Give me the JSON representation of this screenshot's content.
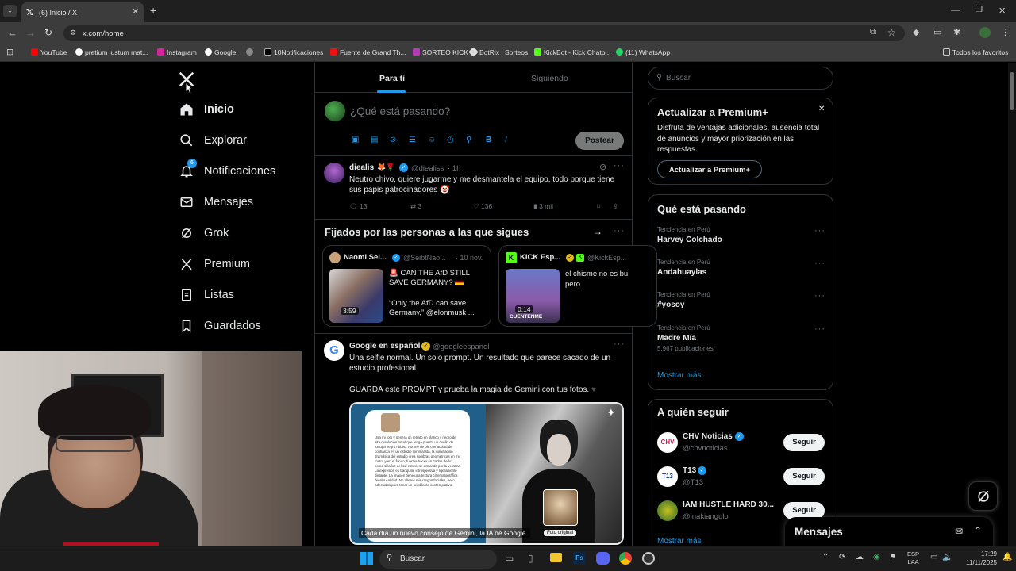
{
  "browser": {
    "tab_title": "(6) Inicio / X",
    "url": "x.com/home",
    "bookmarks": [
      "YouTube",
      "pretium iustum mat...",
      "Instagram",
      "Google",
      "10Notificaciones",
      "Fuente de Grand Th...",
      "SORTEO KICK",
      "BotRix | Sorteos",
      "KickBot - Kick Chatb...",
      "(11) WhatsApp"
    ],
    "all_bookmarks": "Todos los favoritos"
  },
  "nav": {
    "items": [
      "Inicio",
      "Explorar",
      "Notificaciones",
      "Mensajes",
      "Grok",
      "Premium",
      "Listas",
      "Guardados"
    ],
    "notif_badge": "6"
  },
  "feed": {
    "tab_for_you": "Para ti",
    "tab_following": "Siguiendo",
    "compose_placeholder": "¿Qué está pasando?",
    "post_button": "Postear",
    "post1": {
      "name": "diealis",
      "handle": "@diealiss",
      "time": "· 1h",
      "text": "Neutro chivo, quiere jugarme y me desmantela el equipo, todo porque tiene sus papis patrocinadores",
      "replies": "13",
      "reposts": "3",
      "likes": "136",
      "views": "3 mil"
    },
    "pinned_title": "Fijados por las personas a las que sigues",
    "pinned1": {
      "name": "Naomi Sei...",
      "handle": "@SeibtNao...",
      "date": "· 10 nov.",
      "line1": "CAN THE AfD STILL SAVE GERMANY?",
      "line2": "“Only the AfD can save Germany,” @elonmusk ...",
      "duration": "3:59"
    },
    "pinned2": {
      "name": "KICK Esp...",
      "handle": "@KickEsp...",
      "text": "el chisme no es bu pero",
      "duration": "0:14",
      "thumb_caption": "CUENTENME"
    },
    "post2": {
      "name": "Google en español",
      "handle": "@googleespanol",
      "text1": "Una selfie normal. Un solo prompt. Un resultado que parece sacado de un estudio profesional.",
      "text2": "GUARDA este PROMPT y prueba la magia de Gemini con tus fotos.",
      "image_caption": "Cada día un nuevo consejo de Gemini, la IA de Google.",
      "photo_label": "Foto original",
      "phone_text": "Usa mi foto y genera un retrato en blanco y negro de alta resolución en el que tenga puesto un cuello de tortuga negro ribbed. Ponme de pie con actitud de confianza en un estudio minimalista, la iluminación dramática del estudio crea sombras geométricas en mi rostro y en el fondo, fuertes haces cruzados de luz, como si la luz del sol estuviese entrando por la ventana. La expresión es tranquila, introspectiva y ligeramente distante. La imagen tiene una textura cinematográfica de alta calidad. No alteres mis rasgos faciales, pero adecúalos para tener un semblante contemplativo."
    }
  },
  "right": {
    "search_placeholder": "Buscar",
    "premium": {
      "title": "Actualizar a Premium+",
      "text": "Disfruta de ventajas adicionales, ausencia total de anuncios y mayor priorización en las respuestas.",
      "button": "Actualizar a Premium+"
    },
    "trends_title": "Qué está pasando",
    "trends": [
      {
        "category": "Tendencia en Perú",
        "name": "Harvey Colchado",
        "count": ""
      },
      {
        "category": "Tendencia en Perú",
        "name": "Andahuaylas",
        "count": ""
      },
      {
        "category": "Tendencia en Perú",
        "name": "#yosoy",
        "count": ""
      },
      {
        "category": "Tendencia en Perú",
        "name": "Madre Mía",
        "count": "5.967 publicaciones"
      }
    ],
    "show_more": "Mostrar más",
    "follow_title": "A quién seguir",
    "follow": [
      {
        "name": "CHV Noticias",
        "handle": "@chvnoticias",
        "button": "Seguir"
      },
      {
        "name": "T13",
        "handle": "@T13",
        "button": "Seguir"
      },
      {
        "name": "IAM HUSTLE HARD 30...",
        "handle": "@inakiangulo",
        "button": "Seguir"
      }
    ],
    "show_more2": "Mostrar más",
    "messages_drawer": "Mensajes"
  },
  "taskbar": {
    "search": "Buscar",
    "lang1": "ESP",
    "lang2": "LAA",
    "time": "17:29",
    "date": "11/11/2025"
  },
  "colors": {
    "accent": "#1d9bf0",
    "bg": "#000000",
    "border": "#2f3336",
    "muted": "#71767b"
  }
}
